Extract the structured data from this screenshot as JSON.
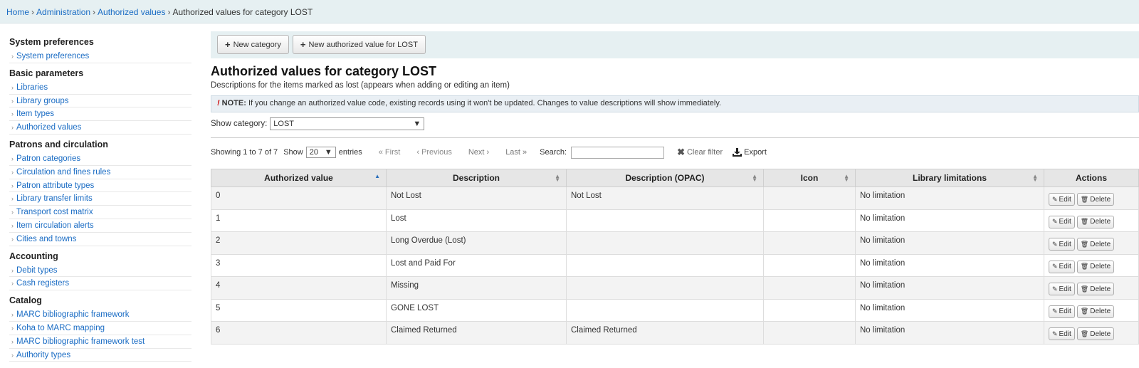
{
  "breadcrumb": {
    "items": [
      "Home",
      "Administration",
      "Authorized values"
    ],
    "current": "Authorized values for category LOST",
    "separator": "›"
  },
  "sidebar": {
    "groups": [
      {
        "heading": "System preferences",
        "items": [
          "System preferences"
        ]
      },
      {
        "heading": "Basic parameters",
        "items": [
          "Libraries",
          "Library groups",
          "Item types",
          "Authorized values"
        ]
      },
      {
        "heading": "Patrons and circulation",
        "items": [
          "Patron categories",
          "Circulation and fines rules",
          "Patron attribute types",
          "Library transfer limits",
          "Transport cost matrix",
          "Item circulation alerts",
          "Cities and towns"
        ]
      },
      {
        "heading": "Accounting",
        "items": [
          "Debit types",
          "Cash registers"
        ]
      },
      {
        "heading": "Catalog",
        "items": [
          "MARC bibliographic framework",
          "Koha to MARC mapping",
          "MARC bibliographic framework test",
          "Authority types"
        ]
      }
    ]
  },
  "toolbar": {
    "new_category": "New category",
    "new_value": "New authorized value for LOST"
  },
  "page": {
    "title": "Authorized values for category LOST",
    "description": "Descriptions for the items marked as lost (appears when adding or editing an item)",
    "note_label": "NOTE:",
    "note_text": " If you change an authorized value code, existing records using it won't be updated. Changes to value descriptions will show immediately.",
    "show_category_label": "Show category:",
    "category_value": "LOST"
  },
  "pager": {
    "info": "Showing 1 to 7 of 7",
    "show_label": "Show",
    "entries_value": "20",
    "entries_label": "entries",
    "first": "« First",
    "previous": "‹ Previous",
    "next": "Next ›",
    "last": "Last »",
    "search_label": "Search:",
    "search_value": "",
    "clear_filter": "Clear filter",
    "export": "Export"
  },
  "table": {
    "headers": [
      "Authorized value",
      "Description",
      "Description (OPAC)",
      "Icon",
      "Library limitations",
      "Actions"
    ],
    "edit_label": "Edit",
    "delete_label": "Delete",
    "rows": [
      {
        "value": "0",
        "description": "Not Lost",
        "opac": "Not Lost",
        "icon": "",
        "library": "No limitation"
      },
      {
        "value": "1",
        "description": "Lost",
        "opac": "",
        "icon": "",
        "library": "No limitation"
      },
      {
        "value": "2",
        "description": "Long Overdue (Lost)",
        "opac": "",
        "icon": "",
        "library": "No limitation"
      },
      {
        "value": "3",
        "description": "Lost and Paid For",
        "opac": "",
        "icon": "",
        "library": "No limitation"
      },
      {
        "value": "4",
        "description": "Missing",
        "opac": "",
        "icon": "",
        "library": "No limitation"
      },
      {
        "value": "5",
        "description": "GONE LOST",
        "opac": "",
        "icon": "",
        "library": "No limitation"
      },
      {
        "value": "6",
        "description": "Claimed Returned",
        "opac": "Claimed Returned",
        "icon": "",
        "library": "No limitation"
      }
    ]
  },
  "colors": {
    "link": "#1a6cc4",
    "header_band": "#e6f0f2",
    "note_bg": "#e9eff4"
  }
}
